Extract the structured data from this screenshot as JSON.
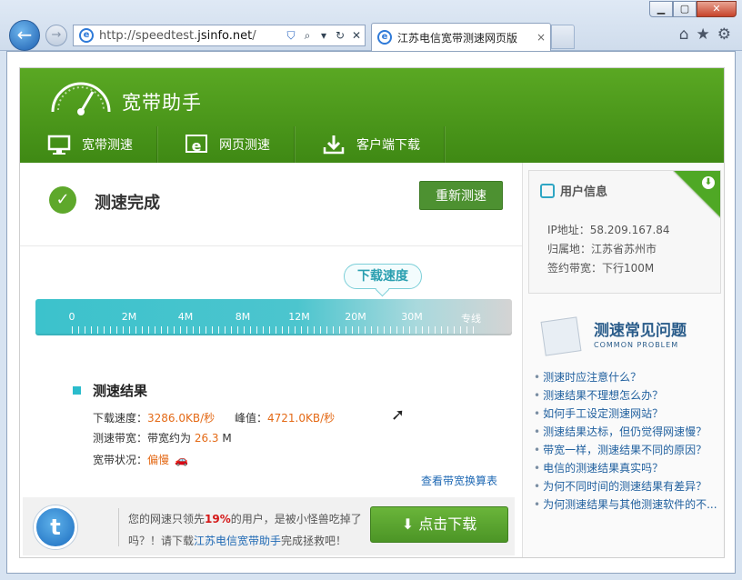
{
  "browser": {
    "window_buttons": [
      "0",
      "1",
      "r"
    ],
    "address_prefix": "http://speedtest.",
    "address_domain": "jsinfo.net",
    "address_suffix": "/",
    "tab_title": "江苏电信宽带测速网页版",
    "tab_close": "×"
  },
  "header": {
    "brand": "宽带助手",
    "nav": [
      "宽带测速",
      "网页测速",
      "客户端下载"
    ]
  },
  "status": {
    "done": "测速完成",
    "retest": "重新测速"
  },
  "meter": {
    "bubble": "下载速度",
    "labels": [
      "0",
      "2M",
      "4M",
      "8M",
      "12M",
      "20M",
      "30M",
      "专线"
    ]
  },
  "results": {
    "title": "测速结果",
    "download_label": "下载速度：",
    "download_value": "3286.0KB/秒",
    "peak_label": "峰值：",
    "peak_value": "4721.0KB/秒",
    "bandwidth_label": "测速带宽：带宽约为 ",
    "bandwidth_value": "26.3",
    "bandwidth_unit": " M",
    "condition_label": "宽带状况：",
    "condition_value": "偏慢",
    "table_link": "查看带宽换算表"
  },
  "promo": {
    "line1_pre": "您的网速只领先",
    "line1_pct": "19%",
    "line1_post": "的用户，是被小怪兽吃掉了",
    "line2_pre": "吗？！请下载",
    "line2_link": "江苏电信宽带助手",
    "line2_post": "完成拯救吧！",
    "download_button": "点击下载"
  },
  "user_info": {
    "title": "用户信息",
    "ip": "IP地址：58.209.167.84",
    "location": "归属地：江苏省苏州市",
    "contract": "签约带宽：下行100M"
  },
  "faq": {
    "title": "测速常见问题",
    "subtitle": "COMMON PROBLEM",
    "items": [
      "测速时应注意什么？",
      "测速结果不理想怎么办？",
      "如何手工设定测速网站？",
      "测速结果达标，但仍觉得网速慢？",
      "带宽一样，测速结果不同的原因？",
      "电信的测速结果真实吗？",
      "为何不同时间的测速结果有差异？",
      "为何测速结果与其他测速软件的不..."
    ]
  }
}
